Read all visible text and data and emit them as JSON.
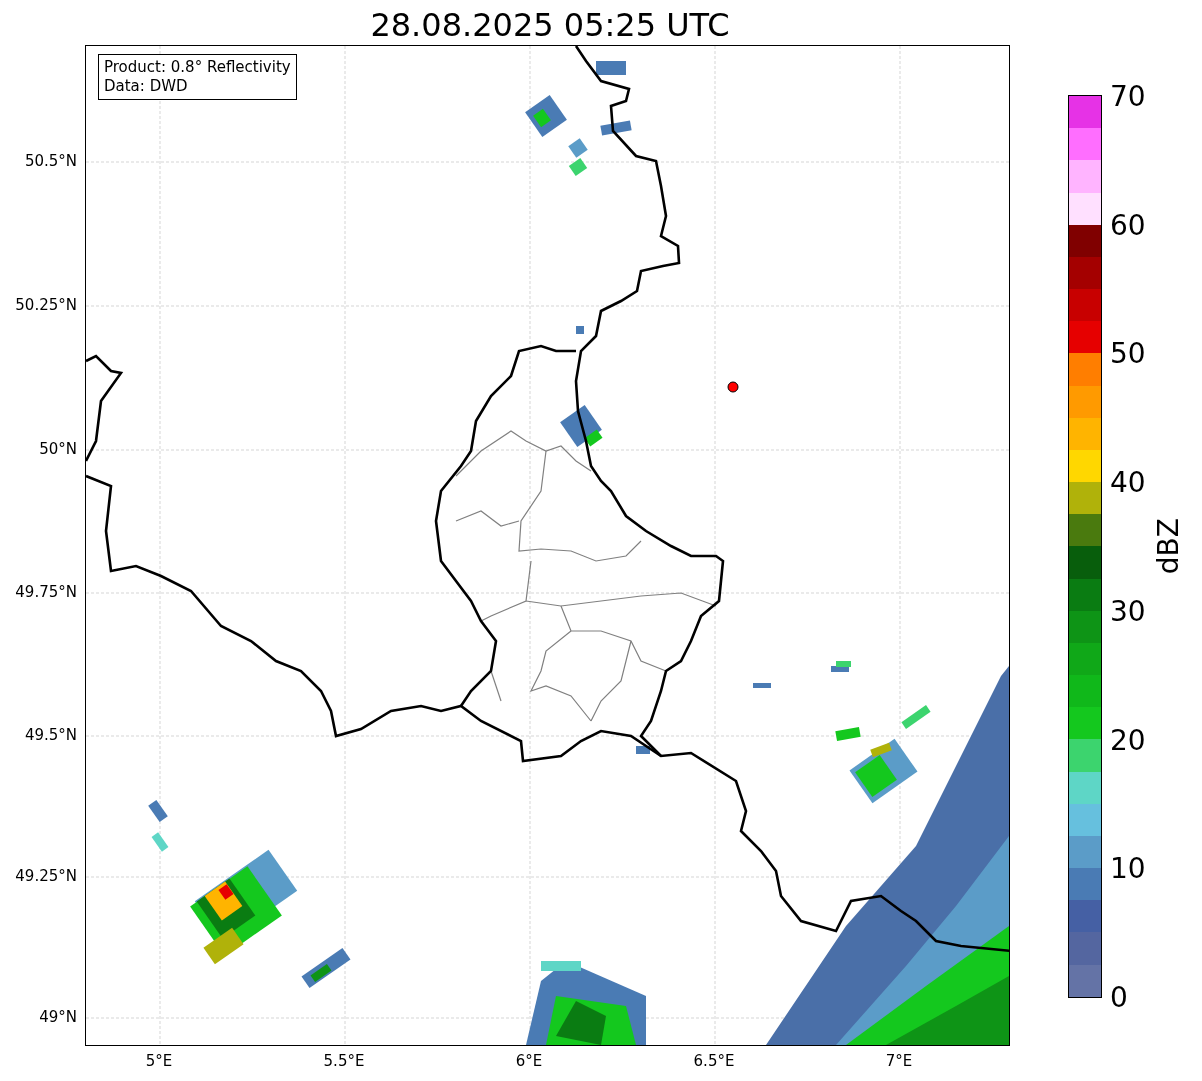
{
  "title": "28.08.2025 05:25 UTC",
  "info_box": {
    "lines": [
      "Product: 0.8° Reflectivity",
      "Data: DWD"
    ]
  },
  "map": {
    "x_ticks": [
      "5°E",
      "5.5°E",
      "6°E",
      "6.5°E",
      "7°E"
    ],
    "y_ticks": [
      "50.5°N",
      "50.25°N",
      "50°N",
      "49.75°N",
      "49.5°N",
      "49.25°N",
      "49°N"
    ]
  },
  "colorbar": {
    "label": "dBZ",
    "ticks": [
      "70",
      "60",
      "50",
      "40",
      "30",
      "20",
      "10",
      "0"
    ],
    "bands": [
      {
        "color": "#e632e6"
      },
      {
        "color": "#ff6eff"
      },
      {
        "color": "#ffb4ff"
      },
      {
        "color": "#ffe0ff"
      },
      {
        "color": "#800000"
      },
      {
        "color": "#a40000"
      },
      {
        "color": "#c80000"
      },
      {
        "color": "#e60000"
      },
      {
        "color": "#ff7e00"
      },
      {
        "color": "#ff9a00"
      },
      {
        "color": "#ffb400"
      },
      {
        "color": "#ffd700"
      },
      {
        "color": "#b0b20a"
      },
      {
        "color": "#4a7a0e"
      },
      {
        "color": "#085e0c"
      },
      {
        "color": "#0a7c12"
      },
      {
        "color": "#0e9416"
      },
      {
        "color": "#10a818"
      },
      {
        "color": "#10b81a"
      },
      {
        "color": "#14c81e"
      },
      {
        "color": "#3cd46e"
      },
      {
        "color": "#5ed6c6"
      },
      {
        "color": "#66c0de"
      },
      {
        "color": "#5b9cc8"
      },
      {
        "color": "#4a7bb4"
      },
      {
        "color": "#4560a4"
      },
      {
        "color": "#5466a0"
      },
      {
        "color": "#6473a6"
      }
    ]
  }
}
